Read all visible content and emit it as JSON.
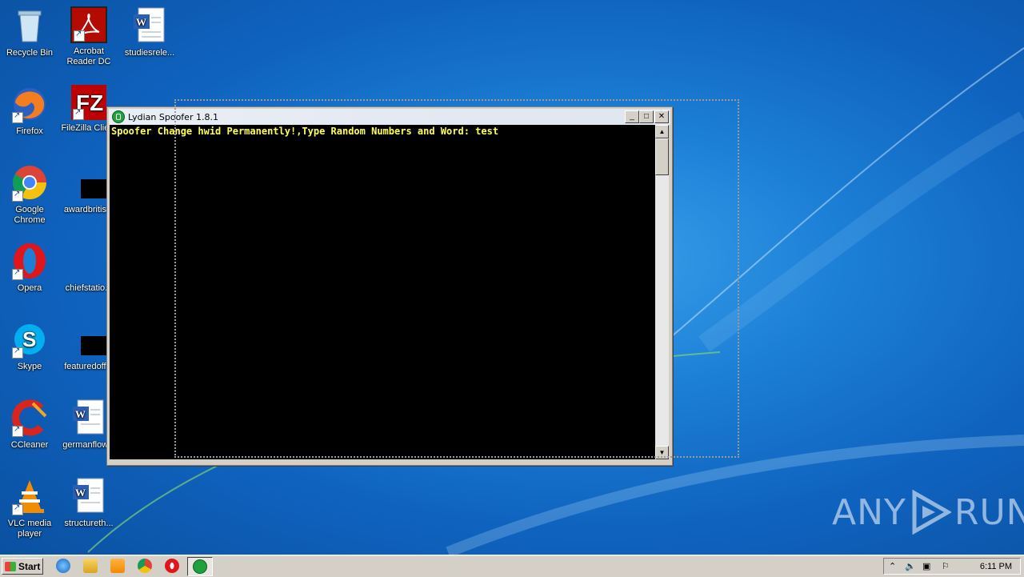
{
  "desktop": {
    "icons": [
      {
        "label": "Recycle Bin",
        "icon": "recycle-bin-icon"
      },
      {
        "label": "Acrobat Reader DC",
        "icon": "acrobat-reader-icon"
      },
      {
        "label": "studiesrele...",
        "icon": "word-document-icon"
      },
      {
        "label": "Firefox",
        "icon": "firefox-icon"
      },
      {
        "label": "FileZilla Clie...",
        "icon": "filezilla-icon"
      },
      {
        "label": "Google Chrome",
        "icon": "chrome-icon"
      },
      {
        "label": "awardbritis...",
        "icon": "file-icon"
      },
      {
        "label": "Opera",
        "icon": "opera-icon"
      },
      {
        "label": "chiefstatio...",
        "icon": "file-icon"
      },
      {
        "label": "Skype",
        "icon": "skype-icon"
      },
      {
        "label": "featuredoff...",
        "icon": "file-icon"
      },
      {
        "label": "CCleaner",
        "icon": "ccleaner-icon"
      },
      {
        "label": "germanflow...",
        "icon": "word-document-icon"
      },
      {
        "label": "VLC media player",
        "icon": "vlc-icon"
      },
      {
        "label": "structureth...",
        "icon": "word-document-icon"
      }
    ]
  },
  "window": {
    "title": "Lydian Spoofer 1.8.1",
    "console_text": "Spoofer Change hwid Permanently!,Type Random Numbers and Word: test",
    "minimize_label": "_",
    "maximize_label": "□",
    "close_label": "✕"
  },
  "watermark": {
    "left": "ANY",
    "right": "RUN"
  },
  "taskbar": {
    "start_label": "Start",
    "clock": "6:11 PM",
    "tray_icons": [
      "chevron-up-icon",
      "volume-icon",
      "network-icon",
      "action-center-flag-icon"
    ],
    "quick_launch": [
      "internet-explorer-icon",
      "file-explorer-icon",
      "media-player-icon",
      "chrome-icon",
      "opera-icon"
    ],
    "active_task_icon": "lydian-spoofer-icon"
  }
}
